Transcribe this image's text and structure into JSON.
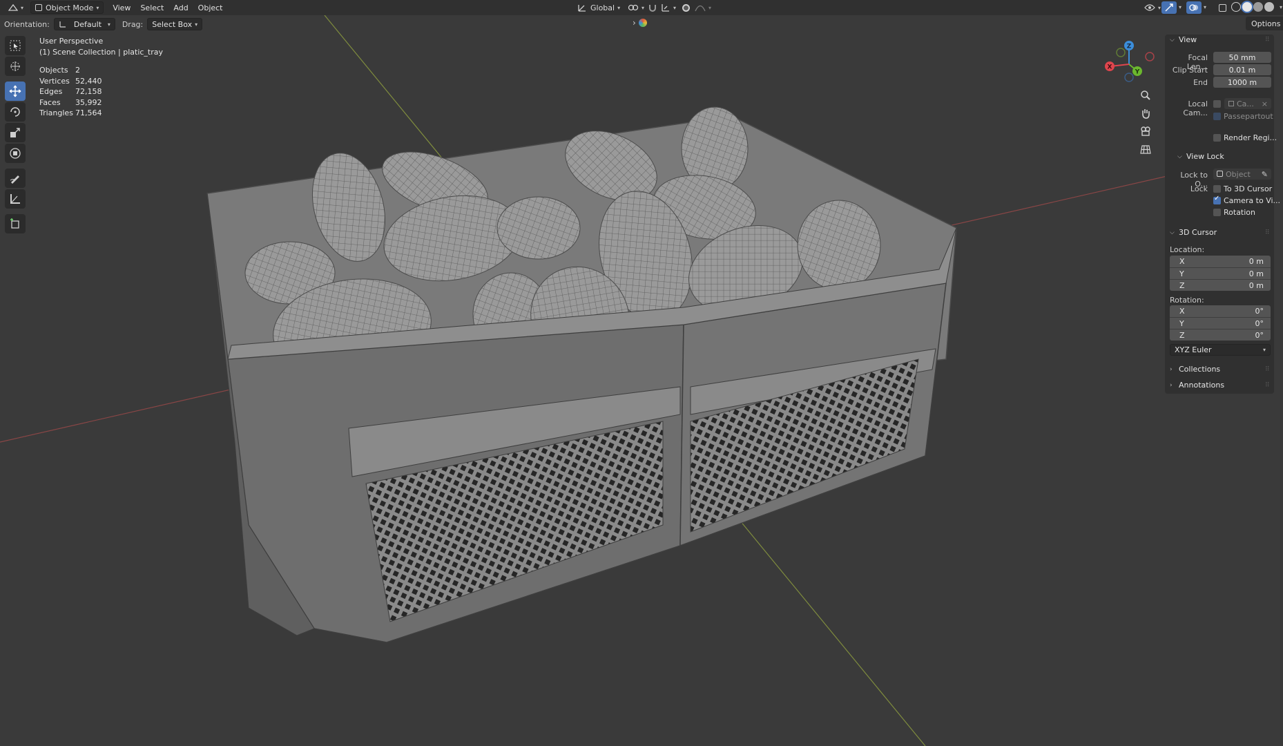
{
  "header": {
    "mode": "Object Mode",
    "menus": [
      "View",
      "Select",
      "Add",
      "Object"
    ],
    "transform_orientation": "Global"
  },
  "subbar": {
    "orientation_label": "Orientation:",
    "orientation_value": "Default",
    "drag_label": "Drag:",
    "drag_value": "Select Box"
  },
  "viewport": {
    "perspective": "User Perspective",
    "collection": "(1) Scene Collection | platic_tray",
    "stats": [
      {
        "key": "Objects",
        "value": "2"
      },
      {
        "key": "Vertices",
        "value": "52,440"
      },
      {
        "key": "Edges",
        "value": "72,158"
      },
      {
        "key": "Faces",
        "value": "35,992"
      },
      {
        "key": "Triangles",
        "value": "71,564"
      }
    ],
    "gizmo": {
      "z": "Z",
      "y": "Y",
      "x": "X"
    }
  },
  "sidebar": {
    "options": "Options",
    "view": {
      "title": "View",
      "focal_label": "Focal Len...",
      "focal_value": "50 mm",
      "clip_start_label": "Clip Start",
      "clip_start_value": "0.01 m",
      "end_label": "End",
      "end_value": "1000 m",
      "local_cam_label": "Local Cam...",
      "local_cam_value": "Ca...",
      "passepartout": "Passepartout",
      "render_region": "Render Regi..."
    },
    "view_lock": {
      "title": "View Lock",
      "lock_to_label": "Lock to O...",
      "lock_to_value": "Object",
      "lock_label": "Lock",
      "to_3d_cursor": "To 3D Cursor",
      "camera_to_view": "Camera to Vi...",
      "rotation": "Rotation"
    },
    "cursor": {
      "title": "3D Cursor",
      "location_label": "Location:",
      "location": [
        {
          "axis": "X",
          "value": "0 m"
        },
        {
          "axis": "Y",
          "value": "0 m"
        },
        {
          "axis": "Z",
          "value": "0 m"
        }
      ],
      "rotation_label": "Rotation:",
      "rotation": [
        {
          "axis": "X",
          "value": "0°"
        },
        {
          "axis": "Y",
          "value": "0°"
        },
        {
          "axis": "Z",
          "value": "0°"
        }
      ],
      "rotation_mode": "XYZ Euler"
    },
    "collections": "Collections",
    "annotations": "Annotations"
  }
}
